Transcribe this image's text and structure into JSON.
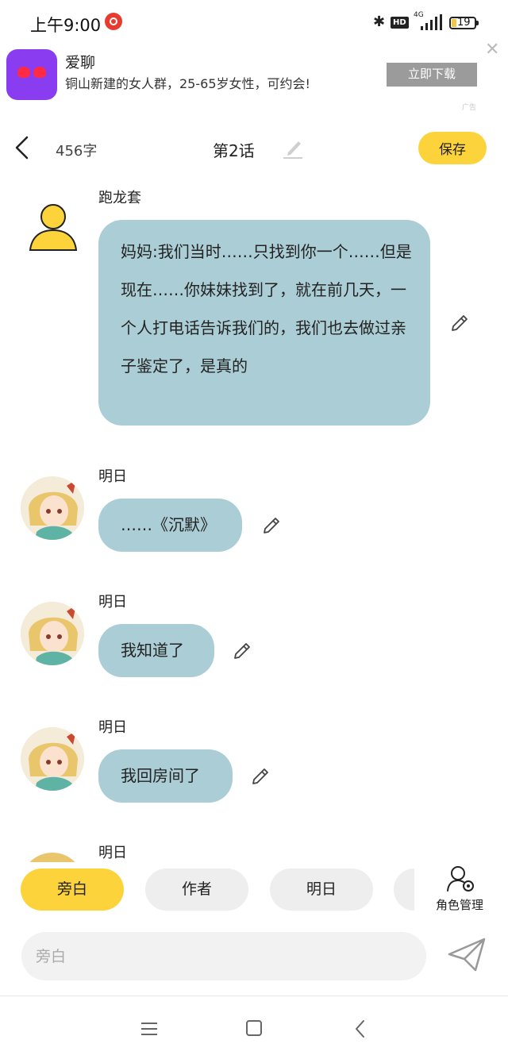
{
  "status": {
    "time": "上午9:00",
    "network": "4G",
    "hd": "HD",
    "battery": "19"
  },
  "ad": {
    "app_name": "爱聊",
    "description": "铜山新建的女人群，25-65岁女性，可约会!",
    "download_label": "立即下载",
    "tag": "广告",
    "close": "✕"
  },
  "header": {
    "word_count": "456字",
    "chapter_title": "第2话",
    "save_label": "保存"
  },
  "messages": [
    {
      "sender": "跑龙套",
      "text": "妈妈:我们当时……只找到你一个……但是现在……你妹妹找到了，就在前几天，一个人打电话告诉我们的，我们也去做过亲子鉴定了，是真的"
    },
    {
      "sender": "明日",
      "text": "……《沉默》"
    },
    {
      "sender": "明日",
      "text": "我知道了"
    },
    {
      "sender": "明日",
      "text": "我回房间了"
    },
    {
      "sender": "明日"
    }
  ],
  "roles": {
    "items": [
      "旁白",
      "作者",
      "明日"
    ],
    "active": "旁白",
    "manage_label": "角色管理"
  },
  "composer": {
    "placeholder": "旁白"
  },
  "colors": {
    "accent": "#fdd33c",
    "bubble": "#abcdd5",
    "chip": "#eeeeee"
  }
}
